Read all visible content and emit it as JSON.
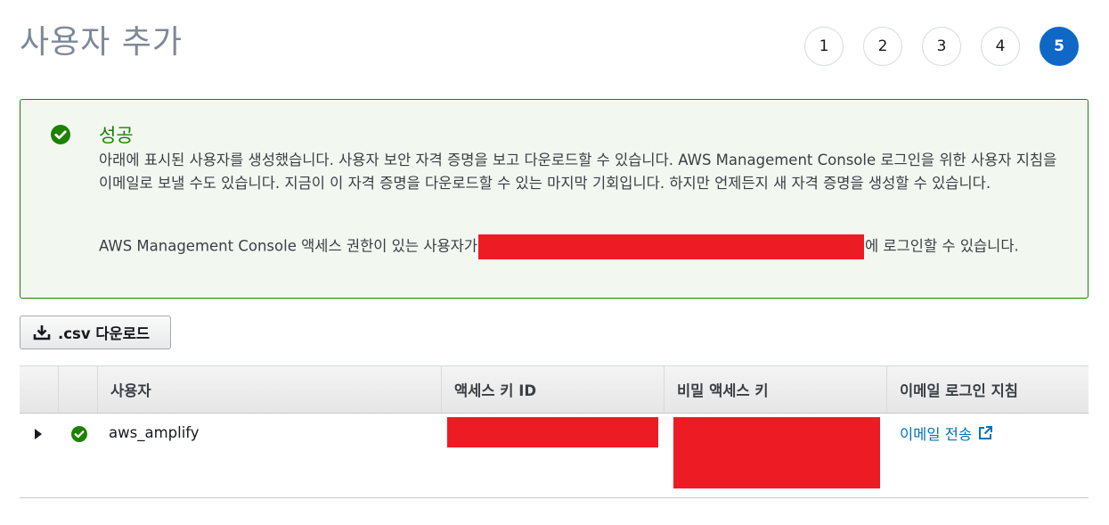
{
  "page": {
    "title": "사용자 추가"
  },
  "steps": {
    "items": [
      "1",
      "2",
      "3",
      "4",
      "5"
    ],
    "active_index": 4,
    "active_color": "#0f68c6"
  },
  "alert": {
    "icon": "check-circle-icon",
    "title": "성공",
    "body": "아래에 표시된 사용자를 생성했습니다. 사용자 보안 자격 증명을 보고 다운로드할 수 있습니다. AWS Management Console 로그인을 위한 사용자 지침을 이메일로 보낼 수도 있습니다. 지금이 이 자격 증명을 다운로드할 수 있는 마지막 기회입니다. 하지만 언제든지 새 자격 증명을 생성할 수 있습니다.",
    "line2_prefix": "AWS Management Console 액세스 권한이 있는 사용자가",
    "line2_suffix": "에 로그인할 수 있습니다.",
    "color": "#1d8102"
  },
  "toolbar": {
    "csv_download_label": ".csv 다운로드",
    "csv_icon": "download-icon"
  },
  "table": {
    "headers": {
      "user": "사용자",
      "access_key_id": "액세스 키 ID",
      "secret_access_key": "비밀 액세스 키",
      "email_instructions": "이메일 로그인 지침"
    },
    "rows": [
      {
        "user": "aws_amplify",
        "status_icon": "check-circle-icon",
        "email_link": "이메일 전송",
        "email_link_icon": "external-link-icon"
      }
    ]
  },
  "redaction_color": "#ed1c24"
}
